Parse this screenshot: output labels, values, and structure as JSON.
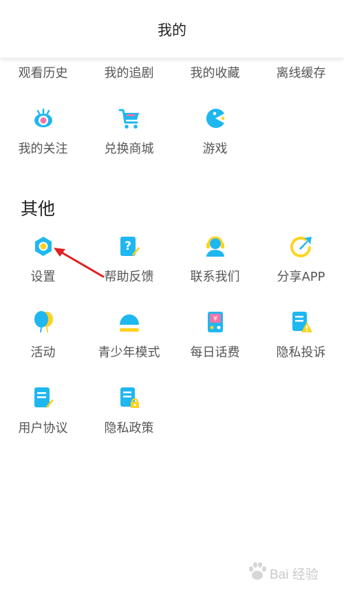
{
  "header": {
    "title": "我的"
  },
  "top_items": [
    {
      "label": "观看历史"
    },
    {
      "label": "我的追剧"
    },
    {
      "label": "我的收藏"
    },
    {
      "label": "离线缓存"
    }
  ],
  "row2_items": [
    {
      "label": "我的关注",
      "icon": "eye-icon"
    },
    {
      "label": "兑换商城",
      "icon": "shopping-cart-icon"
    },
    {
      "label": "游戏",
      "icon": "game-pacman-icon"
    }
  ],
  "other": {
    "title": "其他",
    "items": [
      {
        "label": "设置",
        "icon": "gear-icon"
      },
      {
        "label": "帮助反馈",
        "icon": "help-feedback-icon"
      },
      {
        "label": "联系我们",
        "icon": "customer-service-icon"
      },
      {
        "label": "分享APP",
        "icon": "share-icon"
      },
      {
        "label": "活动",
        "icon": "balloon-icon"
      },
      {
        "label": "青少年模式",
        "icon": "umbrella-icon"
      },
      {
        "label": "每日话费",
        "icon": "phone-credit-icon"
      },
      {
        "label": "隐私投诉",
        "icon": "privacy-complaint-icon"
      },
      {
        "label": "用户协议",
        "icon": "user-agreement-icon"
      },
      {
        "label": "隐私政策",
        "icon": "privacy-policy-icon"
      }
    ]
  },
  "colors": {
    "blue": "#1fb7f0",
    "yellow": "#ffd21f",
    "arrow": "#e02020"
  },
  "watermark": {
    "text": "Bai 经验"
  }
}
